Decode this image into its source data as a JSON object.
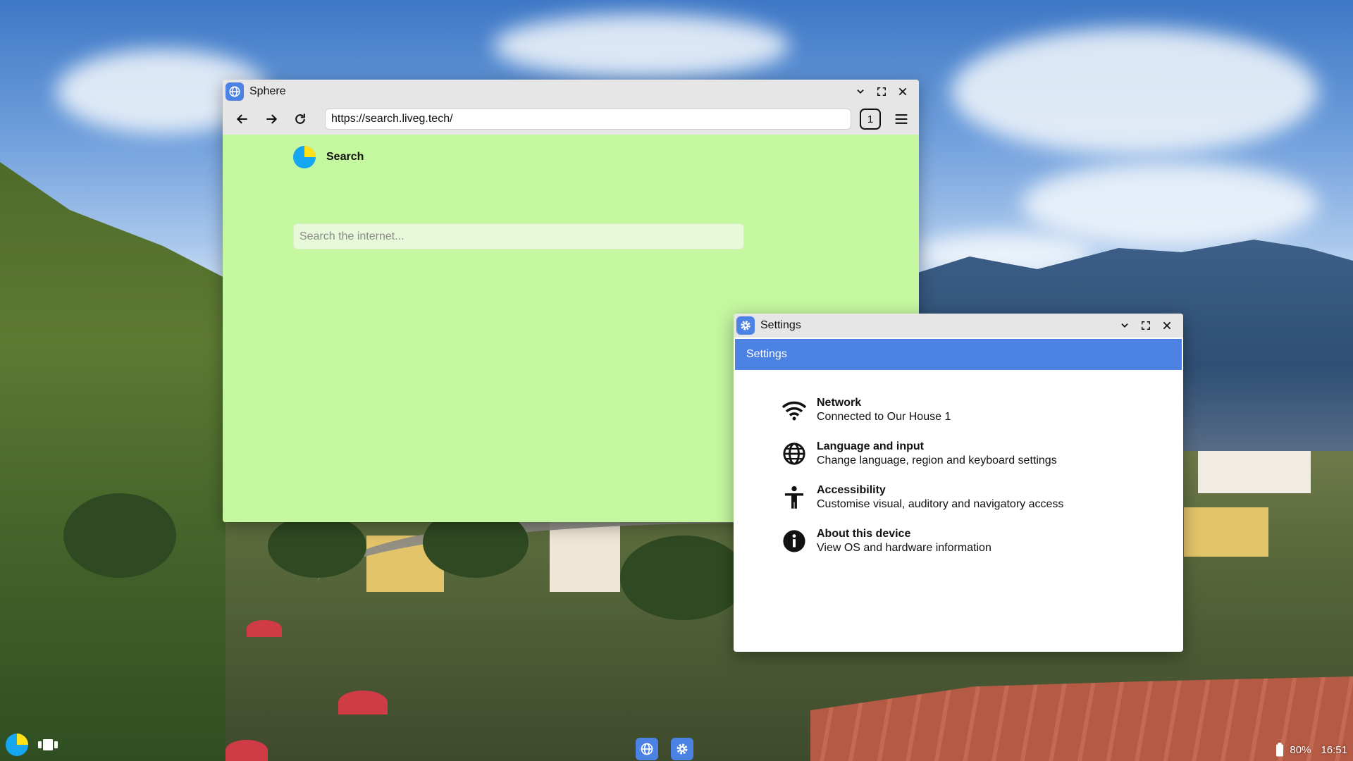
{
  "browser": {
    "title": "Sphere",
    "url": "https://search.liveg.tech/",
    "tab_count": "1",
    "page": {
      "brand": "Search",
      "search_placeholder": "Search the internet..."
    }
  },
  "settings": {
    "title": "Settings",
    "header": "Settings",
    "items": [
      {
        "icon": "wifi-icon",
        "title": "Network",
        "subtitle": "Connected to Our House 1"
      },
      {
        "icon": "globe-icon",
        "title": "Language and input",
        "subtitle": "Change language, region and keyboard settings"
      },
      {
        "icon": "accessibility-icon",
        "title": "Accessibility",
        "subtitle": "Customise visual, auditory and navigatory access"
      },
      {
        "icon": "info-icon",
        "title": "About this device",
        "subtitle": "View OS and hardware information"
      }
    ]
  },
  "taskbar": {
    "battery": "80%",
    "time": "16:51",
    "apps": [
      "globe-icon",
      "gear-icon"
    ]
  },
  "colors": {
    "accent": "#4c82e4",
    "page_background": "#c5f6a0",
    "titlebar": "#e6e6e6"
  }
}
